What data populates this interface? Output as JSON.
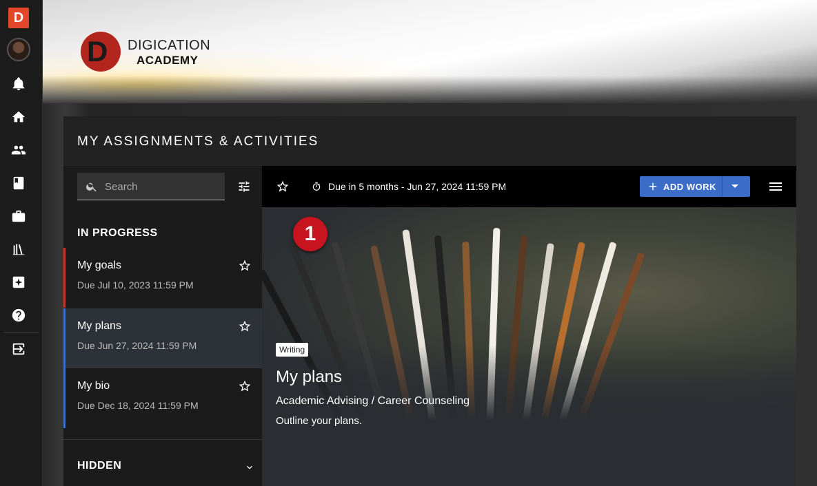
{
  "app": {
    "logo_letter": "D",
    "brand_line1": "DIGICATION",
    "brand_line2": "ACADEMY",
    "brand_mark": "D"
  },
  "rail": {
    "icons": [
      "bell-icon",
      "home-icon",
      "people-icon",
      "book-icon",
      "briefcase-icon",
      "library-icon",
      "sparkle-icon",
      "help-icon",
      "exit-icon"
    ]
  },
  "page": {
    "title": "MY ASSIGNMENTS & ACTIVITIES"
  },
  "search": {
    "placeholder": "Search"
  },
  "sections": {
    "in_progress": "IN PROGRESS",
    "hidden": "HIDDEN"
  },
  "items": [
    {
      "name": "My goals",
      "due": "Due Jul 10, 2023 11:59 PM",
      "accent": "#c0392b"
    },
    {
      "name": "My plans",
      "due": "Due Jun 27, 2024 11:59 PM",
      "accent": "#3b6cc7"
    },
    {
      "name": "My bio",
      "due": "Due Dec 18, 2024 11:59 PM",
      "accent": "#3b6cc7"
    }
  ],
  "toolbar": {
    "due_text": "Due in 5 months - Jun 27, 2024 11:59 PM",
    "add_work_label": "ADD WORK"
  },
  "detail": {
    "step_number": "1",
    "tag": "Writing",
    "title": "My plans",
    "category": "Academic Advising / Career Counseling",
    "description": "Outline your plans."
  },
  "colors": {
    "accent_blue": "#3b6cc7",
    "badge_red": "#c8141f",
    "logo_orange": "#e2472b"
  }
}
